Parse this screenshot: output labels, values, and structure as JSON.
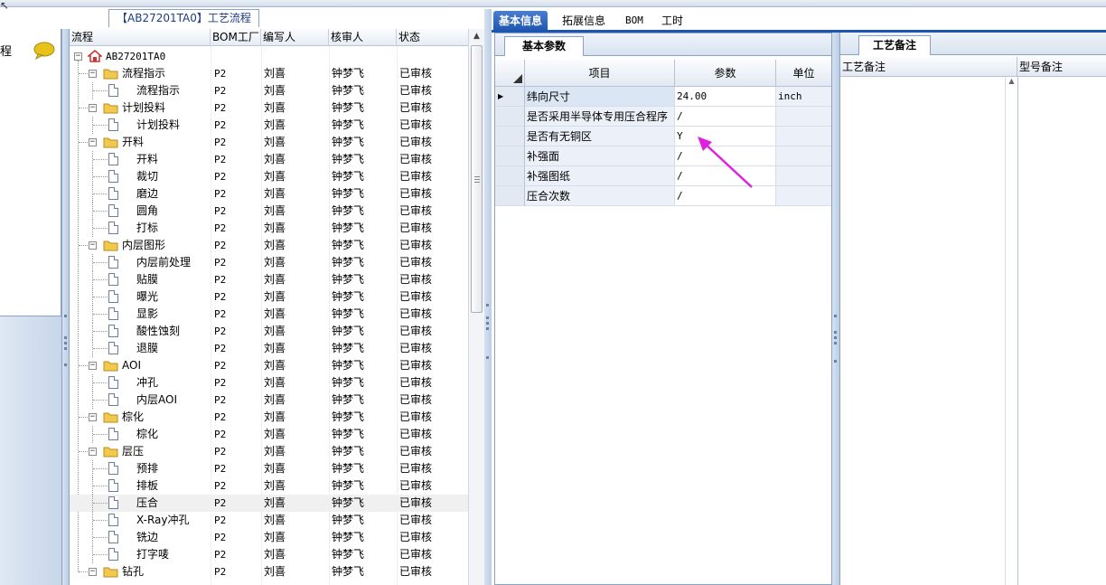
{
  "left_panel": {
    "label": "程"
  },
  "group_title": "【AB27201TA0】工艺流程",
  "tree": {
    "columns": [
      "流程",
      "BOM工厂",
      "编写人",
      "核审人",
      "状态"
    ],
    "root_label": "AB27201TA0",
    "rows": [
      {
        "label": "流程指示",
        "level": 1,
        "bom": "P2",
        "writer": "刘喜",
        "reviewer": "钟梦飞",
        "status": "已审核"
      },
      {
        "label": "流程指示",
        "level": 2,
        "bom": "P2",
        "writer": "刘喜",
        "reviewer": "钟梦飞",
        "status": "已审核"
      },
      {
        "label": "计划投料",
        "level": 1,
        "bom": "P2",
        "writer": "刘喜",
        "reviewer": "钟梦飞",
        "status": "已审核"
      },
      {
        "label": "计划投料",
        "level": 2,
        "bom": "P2",
        "writer": "刘喜",
        "reviewer": "钟梦飞",
        "status": "已审核"
      },
      {
        "label": "开料",
        "level": 1,
        "bom": "P2",
        "writer": "刘喜",
        "reviewer": "钟梦飞",
        "status": "已审核"
      },
      {
        "label": "开料",
        "level": 2,
        "bom": "P2",
        "writer": "刘喜",
        "reviewer": "钟梦飞",
        "status": "已审核"
      },
      {
        "label": "裁切",
        "level": 2,
        "bom": "P2",
        "writer": "刘喜",
        "reviewer": "钟梦飞",
        "status": "已审核"
      },
      {
        "label": "磨边",
        "level": 2,
        "bom": "P2",
        "writer": "刘喜",
        "reviewer": "钟梦飞",
        "status": "已审核"
      },
      {
        "label": "圆角",
        "level": 2,
        "bom": "P2",
        "writer": "刘喜",
        "reviewer": "钟梦飞",
        "status": "已审核"
      },
      {
        "label": "打标",
        "level": 2,
        "bom": "P2",
        "writer": "刘喜",
        "reviewer": "钟梦飞",
        "status": "已审核"
      },
      {
        "label": "内层图形",
        "level": 1,
        "bom": "P2",
        "writer": "刘喜",
        "reviewer": "钟梦飞",
        "status": "已审核"
      },
      {
        "label": "内层前处理",
        "level": 2,
        "bom": "P2",
        "writer": "刘喜",
        "reviewer": "钟梦飞",
        "status": "已审核"
      },
      {
        "label": "贴膜",
        "level": 2,
        "bom": "P2",
        "writer": "刘喜",
        "reviewer": "钟梦飞",
        "status": "已审核"
      },
      {
        "label": "曝光",
        "level": 2,
        "bom": "P2",
        "writer": "刘喜",
        "reviewer": "钟梦飞",
        "status": "已审核"
      },
      {
        "label": "显影",
        "level": 2,
        "bom": "P2",
        "writer": "刘喜",
        "reviewer": "钟梦飞",
        "status": "已审核"
      },
      {
        "label": "酸性蚀刻",
        "level": 2,
        "bom": "P2",
        "writer": "刘喜",
        "reviewer": "钟梦飞",
        "status": "已审核"
      },
      {
        "label": "退膜",
        "level": 2,
        "bom": "P2",
        "writer": "刘喜",
        "reviewer": "钟梦飞",
        "status": "已审核"
      },
      {
        "label": "AOI",
        "level": 1,
        "bom": "P2",
        "writer": "刘喜",
        "reviewer": "钟梦飞",
        "status": "已审核"
      },
      {
        "label": "冲孔",
        "level": 2,
        "bom": "P2",
        "writer": "刘喜",
        "reviewer": "钟梦飞",
        "status": "已审核"
      },
      {
        "label": "内层AOI",
        "level": 2,
        "bom": "P2",
        "writer": "刘喜",
        "reviewer": "钟梦飞",
        "status": "已审核"
      },
      {
        "label": "棕化",
        "level": 1,
        "bom": "P2",
        "writer": "刘喜",
        "reviewer": "钟梦飞",
        "status": "已审核"
      },
      {
        "label": "棕化",
        "level": 2,
        "bom": "P2",
        "writer": "刘喜",
        "reviewer": "钟梦飞",
        "status": "已审核"
      },
      {
        "label": "层压",
        "level": 1,
        "bom": "P2",
        "writer": "刘喜",
        "reviewer": "钟梦飞",
        "status": "已审核"
      },
      {
        "label": "预排",
        "level": 2,
        "bom": "P2",
        "writer": "刘喜",
        "reviewer": "钟梦飞",
        "status": "已审核"
      },
      {
        "label": "排板",
        "level": 2,
        "bom": "P2",
        "writer": "刘喜",
        "reviewer": "钟梦飞",
        "status": "已审核"
      },
      {
        "label": "压合",
        "level": 2,
        "bom": "P2",
        "writer": "刘喜",
        "reviewer": "钟梦飞",
        "status": "已审核",
        "selected": true
      },
      {
        "label": "X-Ray冲孔",
        "level": 2,
        "bom": "P2",
        "writer": "刘喜",
        "reviewer": "钟梦飞",
        "status": "已审核"
      },
      {
        "label": "铣边",
        "level": 2,
        "bom": "P2",
        "writer": "刘喜",
        "reviewer": "钟梦飞",
        "status": "已审核"
      },
      {
        "label": "打字唛",
        "level": 2,
        "bom": "P2",
        "writer": "刘喜",
        "reviewer": "钟梦飞",
        "status": "已审核"
      },
      {
        "label": "钻孔",
        "level": 1,
        "bom": "P2",
        "writer": "刘喜",
        "reviewer": "钟梦飞",
        "status": "已审核"
      }
    ]
  },
  "tabs": [
    "基本信息",
    "拓展信息",
    "BOM",
    "工时"
  ],
  "active_tab": 0,
  "param_panel": {
    "tab_label": "基本参数",
    "columns": [
      "项目",
      "参数",
      "单位"
    ],
    "rows": [
      {
        "item": "纬向尺寸",
        "value": "24.00",
        "unit": "inch"
      },
      {
        "item": "是否采用半导体专用压合程序",
        "value": "/",
        "unit": ""
      },
      {
        "item": "是否有无铜区",
        "value": "Y",
        "unit": ""
      },
      {
        "item": "补强面",
        "value": "/",
        "unit": ""
      },
      {
        "item": "补强图纸",
        "value": "/",
        "unit": ""
      },
      {
        "item": "压合次数",
        "value": "/",
        "unit": ""
      }
    ]
  },
  "notes_panel": {
    "tab_label": "工艺备注",
    "columns": [
      "工艺备注",
      "型号备注"
    ]
  },
  "colors": {
    "accent": "#1e55b0",
    "folder": "#f2c94c",
    "annotation_arrow": "#e020e0",
    "home_icon": "#d03030"
  }
}
